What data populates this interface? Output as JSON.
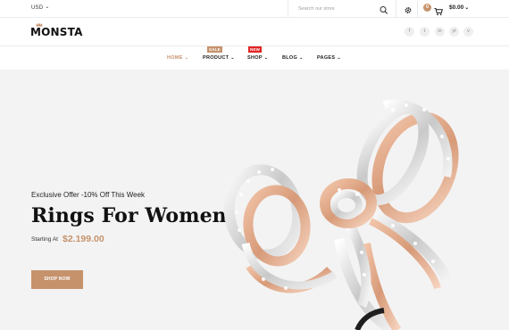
{
  "topbar": {
    "currency": "USD",
    "search_placeholder": "Search our store",
    "cart_count": "0",
    "cart_total": "$0.00"
  },
  "header": {
    "logo": "MONSTA",
    "social": [
      "f",
      "t",
      "in",
      "yt",
      "v"
    ]
  },
  "nav": {
    "items": [
      {
        "label": "HOME",
        "active": true
      },
      {
        "label": "PRODUCT",
        "badge": "SALE"
      },
      {
        "label": "SHOP",
        "badge": "NEW"
      },
      {
        "label": "BLOG"
      },
      {
        "label": "PAGES"
      }
    ]
  },
  "hero": {
    "offer": "Exclusive Offer -10% Off This Week",
    "title": "Rings For Women",
    "starting_label": "Starting At",
    "price": "$2.199.00",
    "button": "SHOP NOW"
  },
  "colors": {
    "accent": "#c6926c",
    "new_badge": "#e02525",
    "hero_bg": "#f3f3f3"
  }
}
